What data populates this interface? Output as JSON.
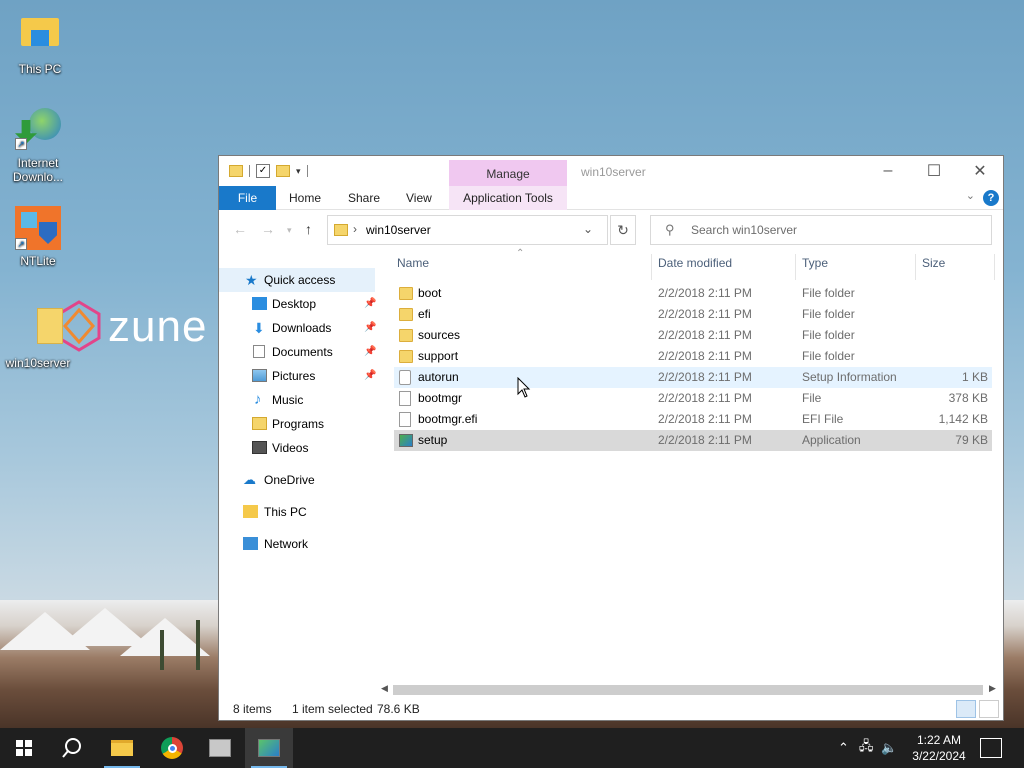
{
  "desktop": {
    "icons": [
      {
        "label": "This PC"
      },
      {
        "label": "Internet Downlo..."
      },
      {
        "label": "NTLite"
      },
      {
        "label": "win10server"
      }
    ],
    "wallpaper_text": "zune"
  },
  "window": {
    "title": "win10server",
    "manage_tab": "Manage",
    "ribbon_tabs": [
      "File",
      "Home",
      "Share",
      "View",
      "Application Tools"
    ],
    "address": {
      "path": "win10server"
    },
    "search": {
      "placeholder": "Search win10server"
    },
    "nav": {
      "quick_access": "Quick access",
      "items": [
        {
          "label": "Desktop",
          "pinned": true
        },
        {
          "label": "Downloads",
          "pinned": true
        },
        {
          "label": "Documents",
          "pinned": true
        },
        {
          "label": "Pictures",
          "pinned": true
        },
        {
          "label": "Music",
          "pinned": false
        },
        {
          "label": "Programs",
          "pinned": false
        },
        {
          "label": "Videos",
          "pinned": false
        }
      ],
      "onedrive": "OneDrive",
      "this_pc": "This PC",
      "network": "Network"
    },
    "columns": [
      "Name",
      "Date modified",
      "Type",
      "Size"
    ],
    "files": [
      {
        "name": "boot",
        "date": "2/2/2018 2:11 PM",
        "type": "File folder",
        "size": ""
      },
      {
        "name": "efi",
        "date": "2/2/2018 2:11 PM",
        "type": "File folder",
        "size": ""
      },
      {
        "name": "sources",
        "date": "2/2/2018 2:11 PM",
        "type": "File folder",
        "size": ""
      },
      {
        "name": "support",
        "date": "2/2/2018 2:11 PM",
        "type": "File folder",
        "size": ""
      },
      {
        "name": "autorun",
        "date": "2/2/2018 2:11 PM",
        "type": "Setup Information",
        "size": "1 KB"
      },
      {
        "name": "bootmgr",
        "date": "2/2/2018 2:11 PM",
        "type": "File",
        "size": "378 KB"
      },
      {
        "name": "bootmgr.efi",
        "date": "2/2/2018 2:11 PM",
        "type": "EFI File",
        "size": "1,142 KB"
      },
      {
        "name": "setup",
        "date": "2/2/2018 2:11 PM",
        "type": "Application",
        "size": "79 KB"
      }
    ],
    "status": {
      "items": "8 items",
      "selected": "1 item selected",
      "selected_size": "78.6 KB"
    }
  },
  "taskbar": {
    "clock_time": "1:22 AM",
    "clock_date": "3/22/2024"
  },
  "colors": {
    "accent": "#1979ca",
    "manage_tab": "#f0c8f0",
    "selection": "#d9d9d9",
    "hover": "#e5f3ff",
    "taskbar": "#1f1f1f"
  }
}
